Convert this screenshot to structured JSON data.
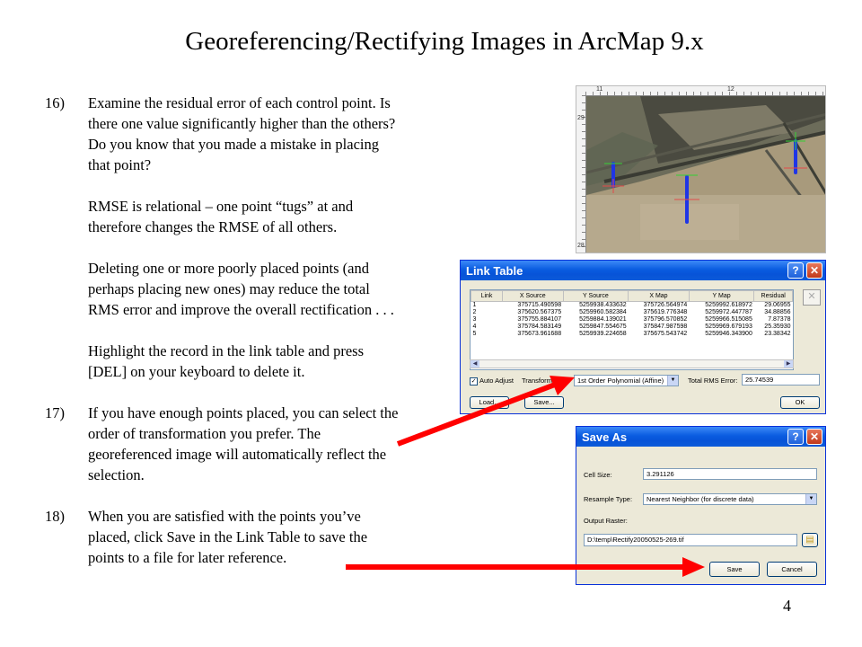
{
  "page": {
    "title": "Georeferencing/Rectifying Images in ArcMap 9.x",
    "page_number": "4"
  },
  "steps": [
    {
      "number": "16)",
      "paragraphs": [
        "Examine the residual error of each control point. Is there one value significantly higher than the others? Do you know that you made a mistake in placing that point?",
        "RMSE is relational – one point “tugs” at and therefore changes the RMSE of all others.",
        "Deleting one or more poorly placed points (and perhaps placing new ones) may reduce the total RMS error and improve the overall rectification . . .",
        "Highlight the record in the link table and press [DEL] on your keyboard to delete it."
      ]
    },
    {
      "number": "17)",
      "paragraphs": [
        "If you have enough points placed, you can select the order of transformation you prefer. The georeferenced image will automatically reflect the selection."
      ]
    },
    {
      "number": "18)",
      "paragraphs": [
        "When you are satisfied with the points you’ve placed, click Save in the Link Table to save the points to a file for later reference."
      ]
    }
  ],
  "aerial": {
    "ruler_labels": [
      "11",
      "12",
      "29",
      "28"
    ]
  },
  "link_table": {
    "title": "Link Table",
    "columns": [
      "Link",
      "X Source",
      "Y Source",
      "X Map",
      "Y Map",
      "Residual"
    ],
    "rows": [
      [
        "1",
        "375715.490598",
        "5259938.433632",
        "375726.564974",
        "5259992.618972",
        "29.06955"
      ],
      [
        "2",
        "375620.567375",
        "5259960.582384",
        "375619.776348",
        "5259972.447787",
        "34.88856"
      ],
      [
        "3",
        "375755.884107",
        "5259884.139021",
        "375796.570852",
        "5259966.515085",
        "7.87378"
      ],
      [
        "4",
        "375784.583149",
        "5259847.554675",
        "375847.987598",
        "5259969.679193",
        "25.35930"
      ],
      [
        "5",
        "375673.961688",
        "5259939.224658",
        "375675.543742",
        "5259946.343900",
        "23.38342"
      ]
    ],
    "auto_adjust_label": "Auto Adjust",
    "auto_adjust_checked": true,
    "transformation_label": "Transformation:",
    "transformation_value": "1st Order Polynomial (Affine)",
    "total_rms_label": "Total RMS Error:",
    "total_rms_value": "25.74539",
    "load_label": "Load...",
    "save_label": "Save...",
    "ok_label": "OK",
    "delete_icon": "x-icon"
  },
  "save_as": {
    "title": "Save As",
    "cell_size_label": "Cell Size:",
    "cell_size_value": "3.291126",
    "resample_label": "Resample Type:",
    "resample_value": "Nearest Neighbor (for discrete data)",
    "output_label": "Output Raster:",
    "output_value": "D:\\temp\\Rectify20050525-269.tif",
    "save_label": "Save",
    "cancel_label": "Cancel",
    "folder_icon": "folder-icon"
  },
  "colors": {
    "arrow": "#ff0000",
    "titlebar": "#0a5ce0",
    "dialog_bg": "#ece9d8"
  }
}
